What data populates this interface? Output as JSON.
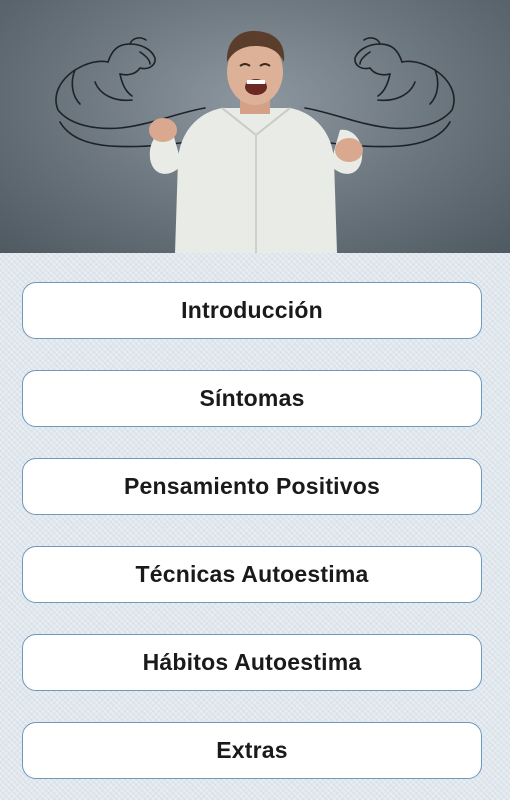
{
  "hero": {
    "image": "man-flexing-muscles-drawing"
  },
  "menu": {
    "items": [
      {
        "label": "Introducción"
      },
      {
        "label": "Síntomas"
      },
      {
        "label": "Pensamiento Positivos"
      },
      {
        "label": "Técnicas Autoestima"
      },
      {
        "label": "Hábitos Autoestima"
      },
      {
        "label": "Extras"
      }
    ]
  },
  "colors": {
    "background": "#dfe7ee",
    "button_border": "#6e99be",
    "button_fill": "#ffffff",
    "text": "#1a1a1a"
  }
}
